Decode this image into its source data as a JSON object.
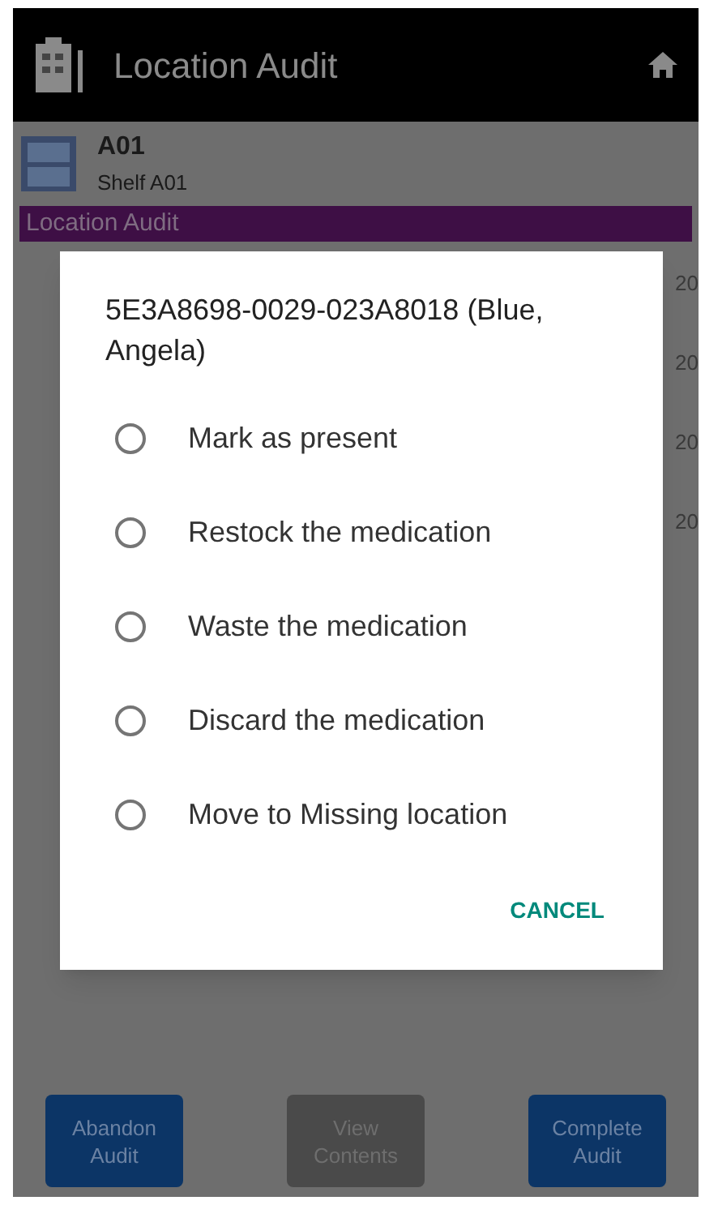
{
  "app_bar": {
    "title": "Location Audit"
  },
  "location": {
    "code": "A01",
    "name": "Shelf A01"
  },
  "section_header": "Location Audit",
  "rows": [
    {
      "column_2": "20"
    },
    {
      "column_2": "20"
    },
    {
      "column_2": "20"
    },
    {
      "column_2": "20"
    }
  ],
  "dialog": {
    "title": "5E3A8698-0029-023A8018 (Blue, Angela)",
    "options": [
      {
        "label": "Mark as present",
        "selected": false
      },
      {
        "label": "Restock the medication",
        "selected": false
      },
      {
        "label": "Waste the medication",
        "selected": false
      },
      {
        "label": "Discard the medication",
        "selected": false
      },
      {
        "label": "Move to Missing location",
        "selected": false
      }
    ],
    "cancel": "CANCEL"
  },
  "buttons": [
    {
      "label": "Abandon Audit",
      "disabled": false
    },
    {
      "label": "View Contents",
      "disabled": true
    },
    {
      "label": "Complete Audit",
      "disabled": false
    }
  ]
}
